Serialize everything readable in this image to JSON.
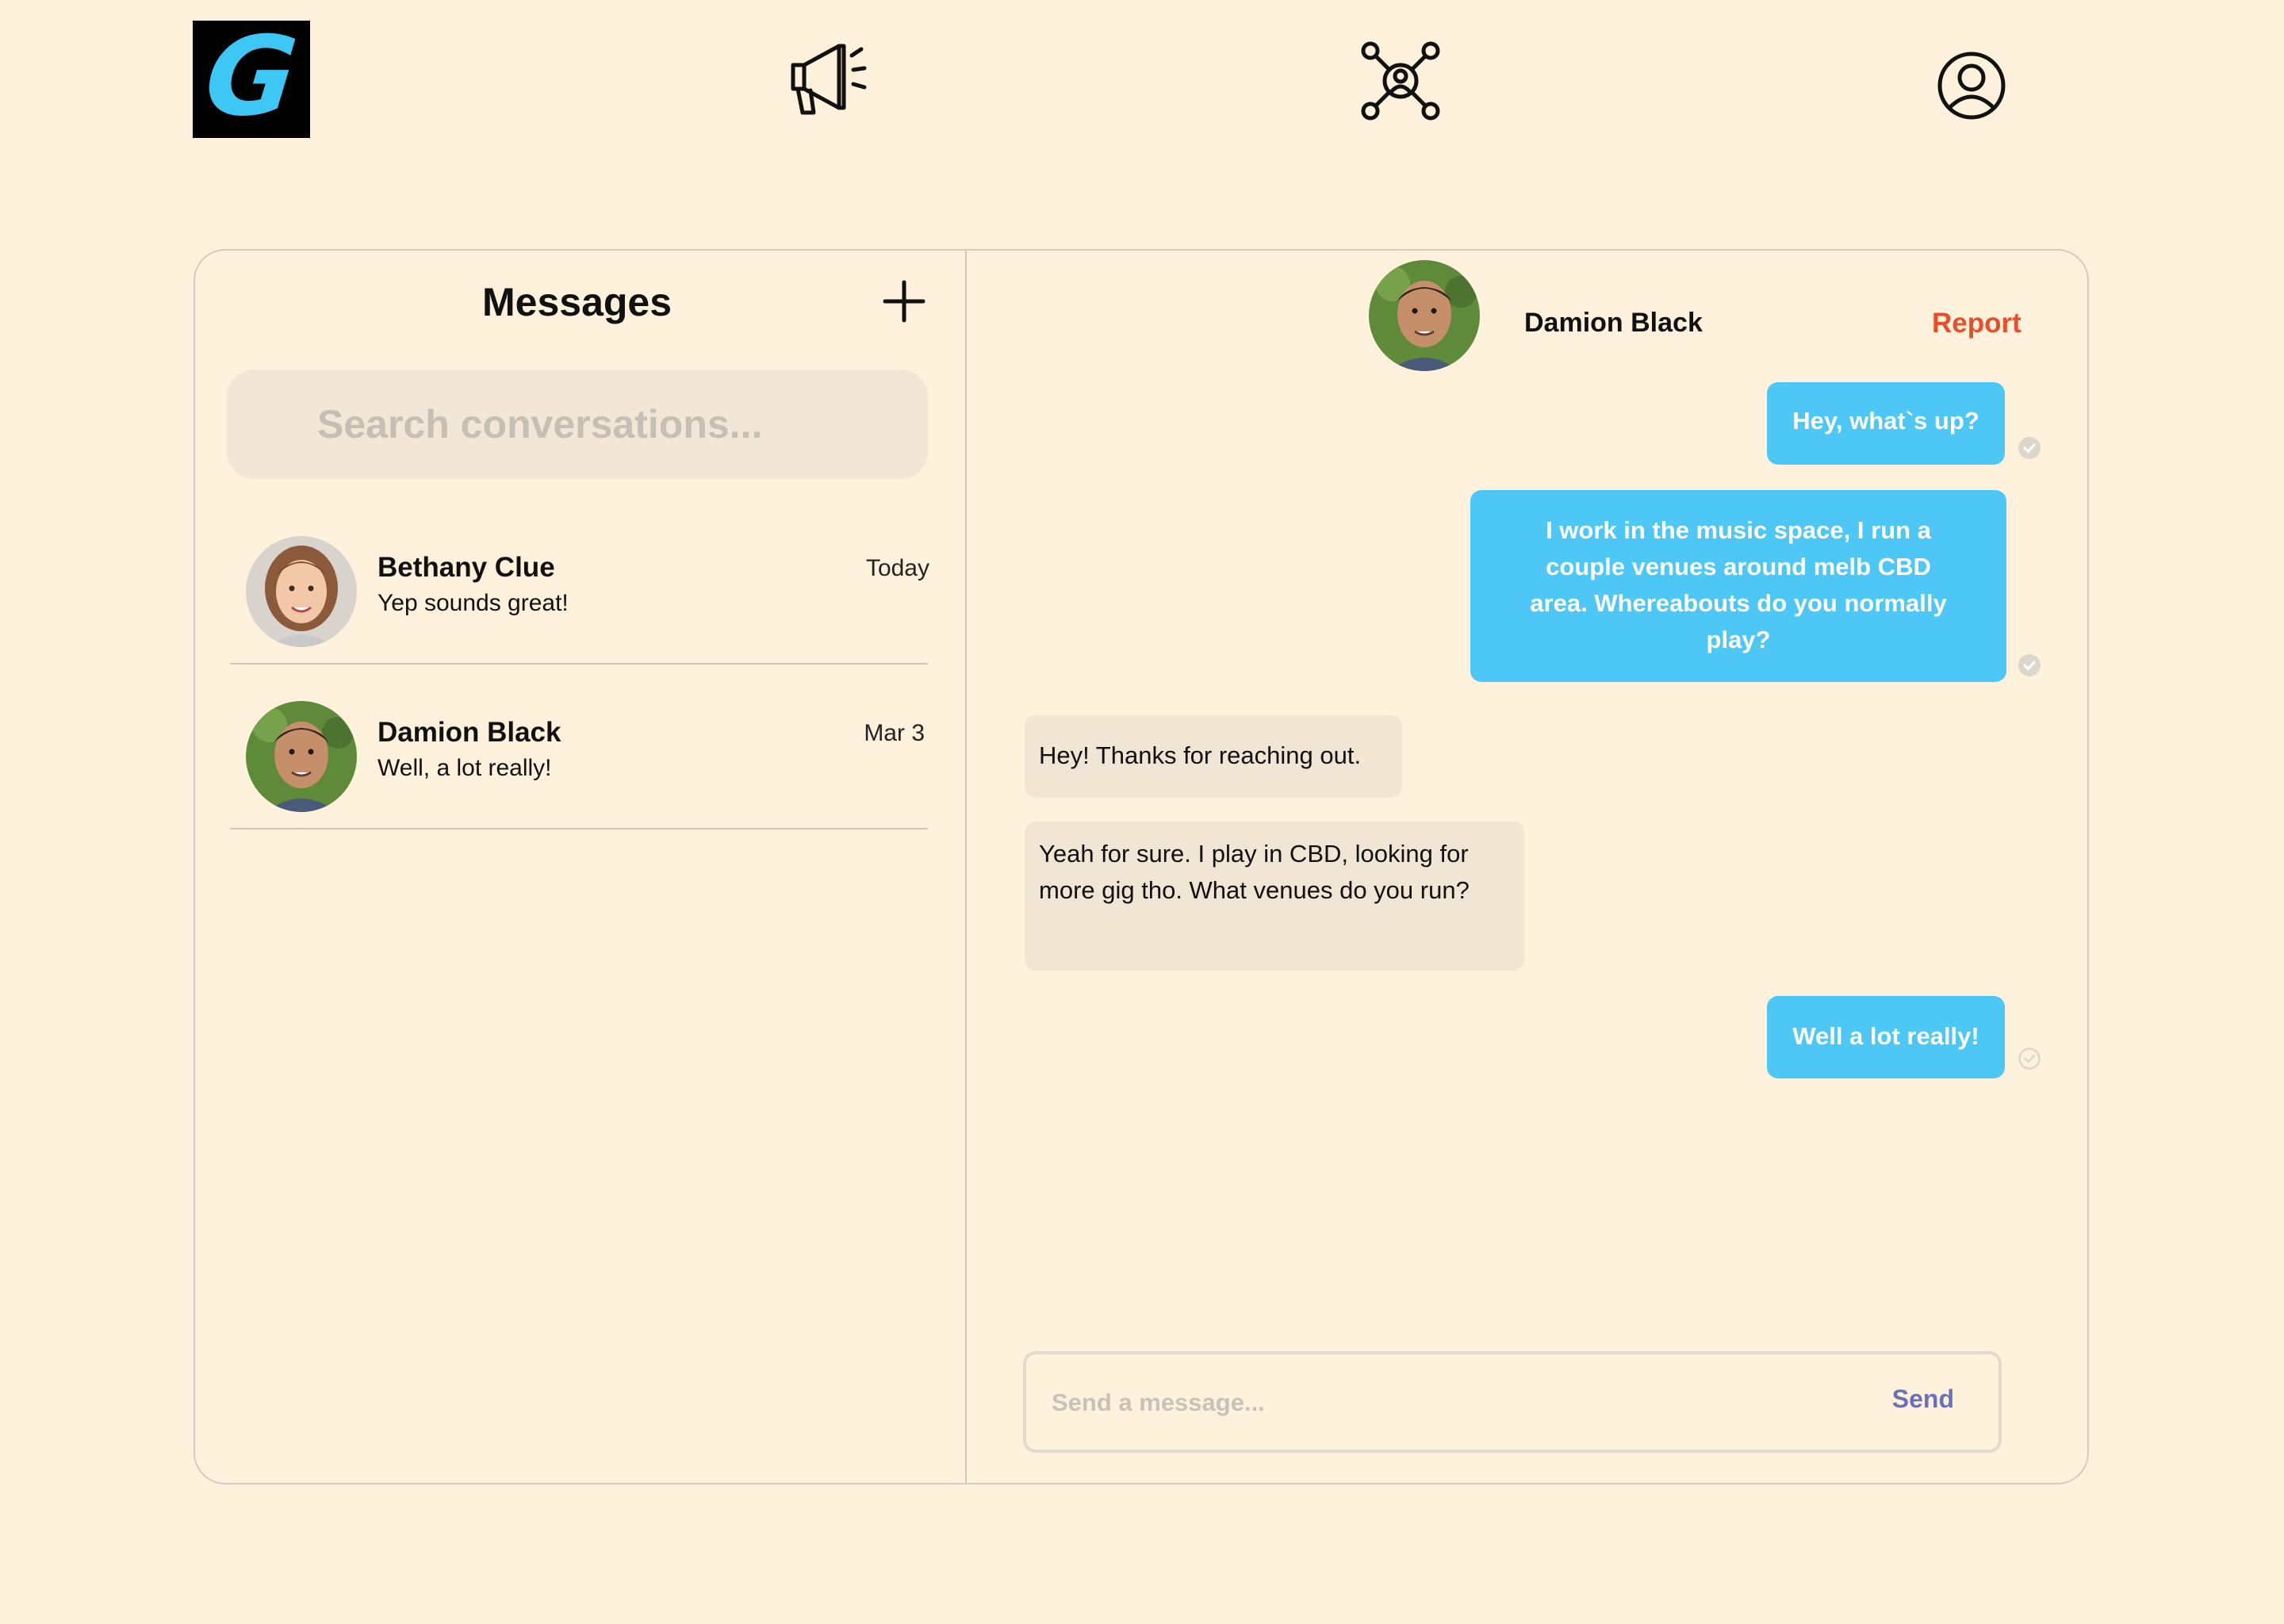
{
  "nav": {
    "logo_letter": "G",
    "icons": [
      "megaphone-icon",
      "network-icon",
      "profile-icon"
    ]
  },
  "messages_panel": {
    "title": "Messages",
    "new_icon": "plus-icon",
    "search_placeholder": "Search conversations...",
    "conversations": [
      {
        "name": "Bethany Clue",
        "preview": "Yep sounds great!",
        "date": "Today"
      },
      {
        "name": "Damion Black",
        "preview": "Well, a lot really!",
        "date": "Mar 3"
      }
    ]
  },
  "chat": {
    "contact_name": "Damion Black",
    "report_label": "Report",
    "messages": [
      {
        "direction": "outgoing",
        "text": "Hey, what`s up?"
      },
      {
        "direction": "outgoing",
        "text": "I work in the music space, I run a couple venues around melb CBD area. Whereabouts do you normally play?"
      },
      {
        "direction": "incoming",
        "text": "Hey! Thanks for reaching out."
      },
      {
        "direction": "incoming",
        "text": "Yeah for sure. I play in CBD, looking for more gig tho. What venues do you run?"
      },
      {
        "direction": "outgoing",
        "text": "Well a lot really!"
      }
    ],
    "composer": {
      "placeholder": "Send a message...",
      "send_label": "Send"
    }
  },
  "colors": {
    "background": "#fff2dc",
    "outgoing_bubble": "#4cc7f6",
    "incoming_bubble": "#f1e5d4",
    "report": "#e94e2c",
    "send": "#6a72b5",
    "logo_bg": "#000000",
    "logo_letter": "#3ec6f4"
  }
}
